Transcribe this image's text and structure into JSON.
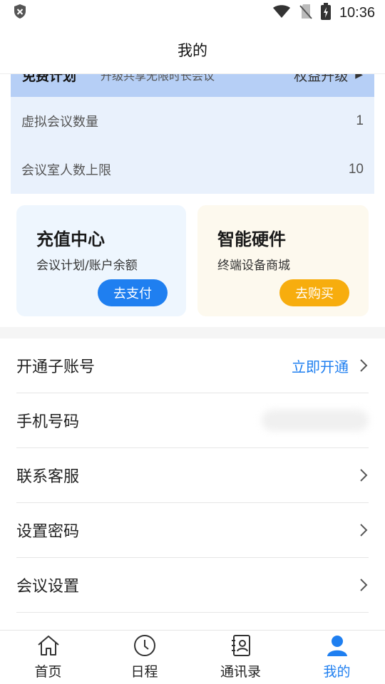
{
  "status_bar": {
    "time": "10:36"
  },
  "header": {
    "title": "我的"
  },
  "plan": {
    "name": "免费计划",
    "desc": "升级共享无限时长会议",
    "upgrade_label": "权益升级",
    "rows": [
      {
        "label": "虚拟会议数量",
        "value": "1"
      },
      {
        "label": "会议室人数上限",
        "value": "10"
      }
    ]
  },
  "promo": {
    "recharge": {
      "title": "充值中心",
      "subtitle": "会议计划/账户余额",
      "button": "去支付"
    },
    "hardware": {
      "title": "智能硬件",
      "subtitle": "终端设备商城",
      "button": "去购买"
    }
  },
  "menu": {
    "sub_account": {
      "label": "开通子账号",
      "action": "立即开通"
    },
    "phone": {
      "label": "手机号码"
    },
    "support": {
      "label": "联系客服"
    },
    "password": {
      "label": "设置密码"
    },
    "meeting_settings": {
      "label": "会议设置"
    }
  },
  "tabs": [
    {
      "label": "首页",
      "icon": "home-icon"
    },
    {
      "label": "日程",
      "icon": "clock-icon"
    },
    {
      "label": "通讯录",
      "icon": "contacts-icon"
    },
    {
      "label": "我的",
      "icon": "person-icon",
      "active": true
    }
  ],
  "colors": {
    "accent": "#1f7ff0",
    "orange": "#f7ad0e",
    "plan_header": "#b6cff6",
    "plan_body": "#e9f1fc"
  }
}
